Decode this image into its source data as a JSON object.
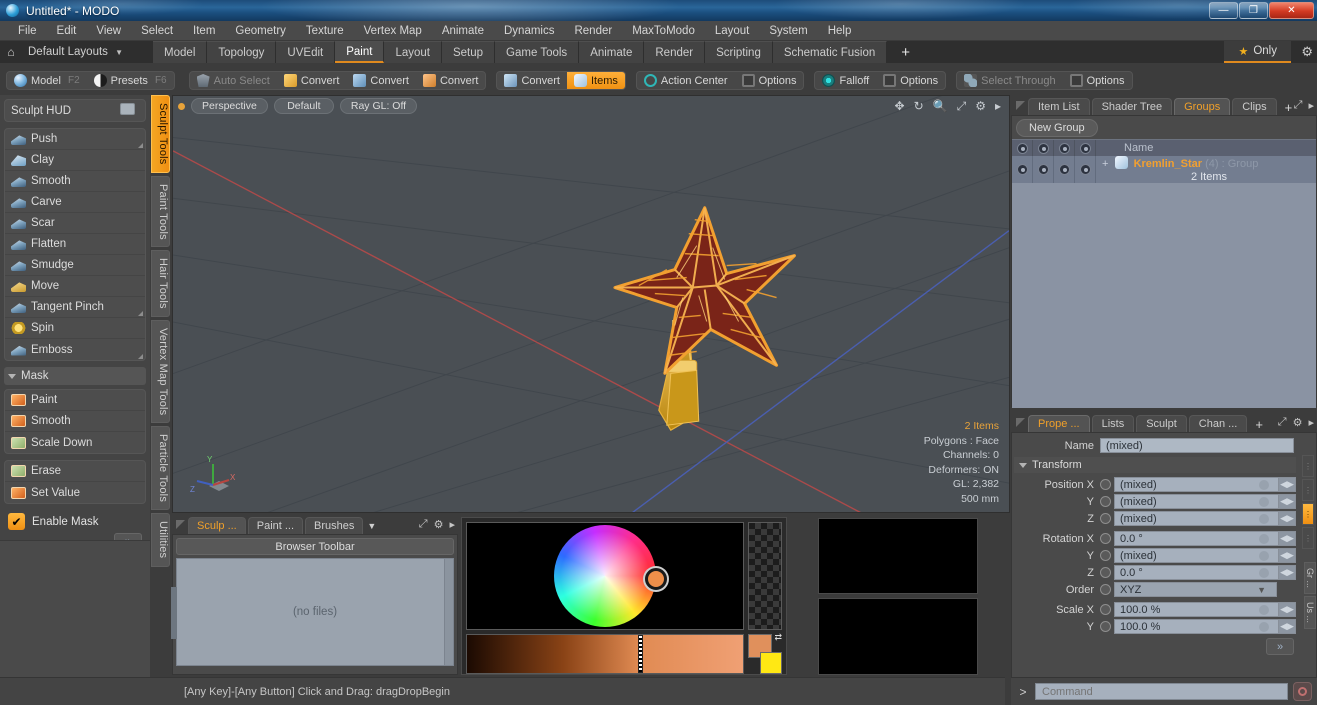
{
  "window": {
    "title": "Untitled* - MODO",
    "app_icon": "modo-icon",
    "minimize": "—",
    "maximize": "❐",
    "close": "✕"
  },
  "menubar": {
    "items": [
      "File",
      "Edit",
      "View",
      "Select",
      "Item",
      "Geometry",
      "Texture",
      "Vertex Map",
      "Animate",
      "Dynamics",
      "Render",
      "MaxToModo",
      "Layout",
      "System",
      "Help"
    ]
  },
  "layoutbar": {
    "home_icon": "home-icon",
    "default_layouts": "Default Layouts",
    "caret": "▼",
    "tabs": [
      {
        "label": "Model",
        "active": false
      },
      {
        "label": "Topology",
        "active": false
      },
      {
        "label": "UVEdit",
        "active": false
      },
      {
        "label": "Paint",
        "active": true
      },
      {
        "label": "Layout",
        "active": false
      },
      {
        "label": "Setup",
        "active": false
      },
      {
        "label": "Game Tools",
        "active": false
      },
      {
        "label": "Animate",
        "active": false
      },
      {
        "label": "Render",
        "active": false
      },
      {
        "label": "Scripting",
        "active": false
      },
      {
        "label": "Schematic Fusion",
        "active": false
      }
    ],
    "add_tab": "+",
    "only_label": "Only",
    "star_icon": "star-icon",
    "gear_icon": "gear-icon"
  },
  "modebar": {
    "group1": [
      {
        "label": "Model",
        "hotkey": "F2",
        "icon": "sphere-icon",
        "state": "normal"
      },
      {
        "label": "Presets",
        "hotkey": "F6",
        "icon": "presets-icon",
        "state": "normal"
      }
    ],
    "group2": [
      {
        "label": "Auto Select",
        "icon": "shield-icon",
        "state": "dim"
      },
      {
        "label": "Convert",
        "icon": "cube-yellow-icon",
        "state": "normal"
      },
      {
        "label": "Convert",
        "icon": "cube-blue-icon",
        "state": "normal"
      },
      {
        "label": "Convert",
        "icon": "cube-orange-icon",
        "state": "normal"
      }
    ],
    "group3": [
      {
        "label": "Convert",
        "icon": "cube-gray-icon",
        "state": "normal"
      },
      {
        "label": "Items",
        "icon": "items-icon",
        "state": "active"
      }
    ],
    "group4": [
      {
        "label": "Action Center",
        "icon": "action-center-icon",
        "state": "normal"
      },
      {
        "label": "Options",
        "icon": "options-square-icon",
        "state": "normal"
      }
    ],
    "group5": [
      {
        "label": "Falloff",
        "icon": "falloff-icon",
        "state": "normal"
      },
      {
        "label": "Options",
        "icon": "options-square-icon",
        "state": "normal"
      }
    ],
    "group6": [
      {
        "label": "Select Through",
        "icon": "select-through-icon",
        "state": "dim"
      },
      {
        "label": "Options",
        "icon": "options-square-icon",
        "state": "normal"
      }
    ]
  },
  "left_panel": {
    "hud_button": {
      "label": "Sculpt HUD",
      "icon": "hud-icon"
    },
    "tools": [
      {
        "label": "Push",
        "icon": "brush-push-icon",
        "has_corner": true
      },
      {
        "label": "Clay",
        "icon": "brush-clay-icon",
        "has_corner": false
      },
      {
        "label": "Smooth",
        "icon": "brush-smooth-icon",
        "has_corner": false
      },
      {
        "label": "Carve",
        "icon": "brush-carve-icon",
        "has_corner": false
      },
      {
        "label": "Scar",
        "icon": "brush-scar-icon",
        "has_corner": false
      },
      {
        "label": "Flatten",
        "icon": "brush-flatten-icon",
        "has_corner": false
      },
      {
        "label": "Smudge",
        "icon": "brush-smudge-icon",
        "has_corner": false
      },
      {
        "label": "Move",
        "icon": "brush-move-icon",
        "has_corner": false
      },
      {
        "label": "Tangent Pinch",
        "icon": "brush-pinch-icon",
        "has_corner": true
      },
      {
        "label": "Spin",
        "icon": "brush-spin-icon",
        "has_corner": false
      },
      {
        "label": "Emboss",
        "icon": "brush-emboss-icon",
        "has_corner": true
      }
    ],
    "mask_section": {
      "title": "Mask",
      "items_a": [
        {
          "label": "Paint",
          "icon": "mask-paint-icon"
        },
        {
          "label": "Smooth",
          "icon": "mask-smooth-icon"
        },
        {
          "label": "Scale Down",
          "icon": "mask-scale-icon"
        }
      ],
      "items_b": [
        {
          "label": "Erase",
          "icon": "mask-erase-icon"
        },
        {
          "label": "Set Value",
          "icon": "mask-setvalue-icon"
        }
      ],
      "enable_mask": {
        "label": "Enable Mask",
        "checked": true,
        "check_glyph": "✔"
      },
      "expand": "»"
    }
  },
  "vertical_tabs": [
    {
      "label": "Sculpt Tools",
      "active": true
    },
    {
      "label": "Paint Tools",
      "active": false
    },
    {
      "label": "Hair Tools",
      "active": false
    },
    {
      "label": "Vertex Map Tools",
      "active": false
    },
    {
      "label": "Particle Tools",
      "active": false
    },
    {
      "label": "Utilities",
      "active": false
    }
  ],
  "viewport": {
    "view_mode": "Perspective",
    "shading": "Default",
    "raygl": "Ray GL: Off",
    "nav_icons": [
      "pan-icon",
      "rotate-icon",
      "zoom-icon",
      "fit-icon",
      "gear-icon",
      "more-arrow-icon"
    ],
    "hud": {
      "items": "2 Items",
      "polygons": "Polygons : Face",
      "channels": "Channels: 0",
      "deformers": "Deformers: ON",
      "gl": "GL: 2,382",
      "scale": "500 mm"
    },
    "axis_labels": {
      "x": "X",
      "y": "Y",
      "z": "Z"
    },
    "model_name": "Kremlin_Star"
  },
  "right_top_panel": {
    "tabs": [
      {
        "label": "Item List",
        "active": false
      },
      {
        "label": "Shader Tree",
        "active": false
      },
      {
        "label": "Groups",
        "active": true
      },
      {
        "label": "Clips",
        "active": false
      }
    ],
    "add_tab": "+",
    "icons": [
      "expand-icon",
      "more-arrow-icon"
    ],
    "new_group_button": "New Group",
    "columns": [
      "visibility-icon",
      "render-icon",
      "lock-icon",
      "info-icon",
      "Name"
    ],
    "rows": [
      {
        "expander": "+",
        "icon": "group-icon",
        "name": "Kremlin_Star",
        "index": "(4)",
        "type": ": Group",
        "subtitle": "2 Items"
      }
    ]
  },
  "right_bottom_panel": {
    "tabs": [
      {
        "label": "Prope ...",
        "active": true
      },
      {
        "label": "Lists",
        "active": false
      },
      {
        "label": "Sculpt",
        "active": false
      },
      {
        "label": "Chan ...",
        "active": false
      }
    ],
    "add_tab": "+",
    "icons": [
      "expand-icon",
      "gear-icon",
      "more-arrow-icon"
    ],
    "name_label": "Name",
    "name_value": "(mixed)",
    "transform_section": "Transform",
    "fields": [
      {
        "label": "Position X",
        "value": "(mixed)"
      },
      {
        "label": "Y",
        "value": "(mixed)"
      },
      {
        "label": "Z",
        "value": "(mixed)"
      },
      {
        "label": "Rotation X",
        "value": "0.0 °"
      },
      {
        "label": "Y",
        "value": "(mixed)"
      },
      {
        "label": "Z",
        "value": "0.0 °"
      }
    ],
    "order": {
      "label": "Order",
      "value": "XYZ",
      "caret": "▼"
    },
    "scale": [
      {
        "label": "Scale X",
        "value": "100.0 %"
      },
      {
        "label": "Y",
        "value": "100.0 %"
      }
    ],
    "expand": "»",
    "side_tabs": [
      "Gr ...",
      "Us ..."
    ]
  },
  "browser_panel": {
    "tabs": [
      {
        "label": "Sculp ...",
        "active": true
      },
      {
        "label": "Paint ...",
        "active": false
      },
      {
        "label": "Brushes",
        "active": false
      }
    ],
    "dropdown_caret": "▼",
    "icons": [
      "expand-icon",
      "gear-icon",
      "more-arrow-icon"
    ],
    "toolbar_label": "Browser Toolbar",
    "empty_text": "(no files)"
  },
  "color_picker": {
    "wheel": "color-wheel",
    "selected_color": "#ef8f4a",
    "foreground_color": "#e0905c",
    "background_color": "#ffe814",
    "swap_icon": "swap-colors-icon",
    "alpha_checker": "alpha-checkerboard"
  },
  "statusbar": {
    "hint": "[Any Key]-[Any Button] Click and Drag:    dragDropBegin"
  },
  "command_bar": {
    "prompt": ">",
    "placeholder": "Command",
    "record_icon": "record-icon"
  },
  "colors": {
    "accent": "#f0a02a",
    "panel_bg": "#4a4a4a",
    "viewport_bg": "#4a4f54",
    "title_blue": "#2a6699",
    "model_gold": "#f0a030",
    "model_red": "#7a2418"
  }
}
